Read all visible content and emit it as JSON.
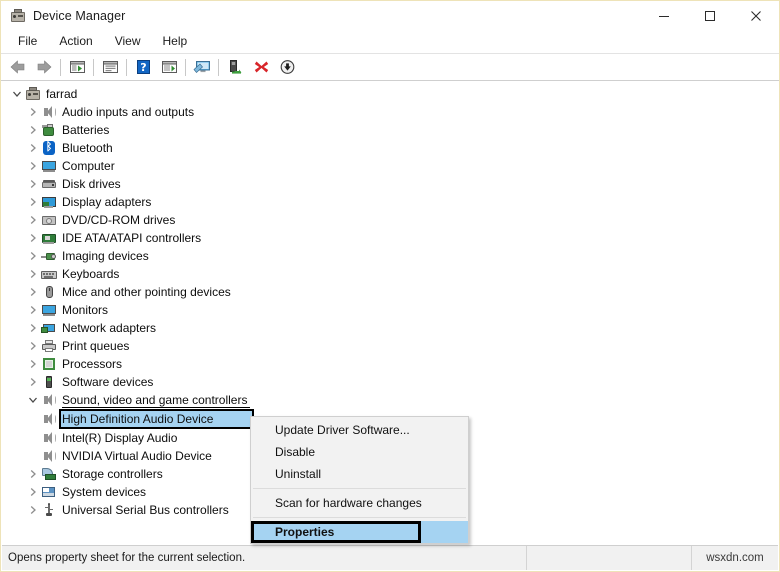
{
  "window": {
    "title": "Device Manager",
    "icon": "device-manager-icon",
    "border_color": "#eee3b8",
    "controls": [
      {
        "name": "minimize-button",
        "glyph": "minimize"
      },
      {
        "name": "maximize-button",
        "glyph": "maximize"
      },
      {
        "name": "close-button",
        "glyph": "close"
      }
    ]
  },
  "menubar": {
    "items": [
      {
        "label": "File"
      },
      {
        "label": "Action"
      },
      {
        "label": "View"
      },
      {
        "label": "Help"
      }
    ]
  },
  "toolbar": {
    "buttons": [
      {
        "name": "back-button",
        "icon": "back-arrow-icon"
      },
      {
        "name": "forward-button",
        "icon": "forward-arrow-icon"
      },
      {
        "name": "show-hide-console-tree-button",
        "icon": "console-tree-icon"
      },
      {
        "name": "properties-button",
        "icon": "properties-window-icon"
      },
      {
        "name": "help-button",
        "icon": "help-question-icon"
      },
      {
        "name": "update-driver-button",
        "icon": "update-driver-icon"
      },
      {
        "name": "scan-hardware-changes-button",
        "icon": "scan-hardware-icon"
      },
      {
        "name": "enable-device-button",
        "icon": "enable-device-icon"
      },
      {
        "name": "uninstall-device-button",
        "icon": "uninstall-red-x-icon"
      },
      {
        "name": "disable-device-button",
        "icon": "disable-down-arrow-icon"
      }
    ]
  },
  "tree": {
    "root": {
      "label": "farrad",
      "icon": "computer-device-icon",
      "expanded": true
    },
    "nodes": [
      {
        "label": "Audio inputs and outputs",
        "icon": "speaker-icon",
        "expanded": false,
        "indent": 1
      },
      {
        "label": "Batteries",
        "icon": "battery-icon",
        "expanded": false,
        "indent": 1
      },
      {
        "label": "Bluetooth",
        "icon": "bluetooth-icon",
        "expanded": false,
        "indent": 1
      },
      {
        "label": "Computer",
        "icon": "monitor-icon",
        "expanded": false,
        "indent": 1
      },
      {
        "label": "Disk drives",
        "icon": "disk-drive-icon",
        "expanded": false,
        "indent": 1
      },
      {
        "label": "Display adapters",
        "icon": "display-adapter-icon",
        "expanded": false,
        "indent": 1
      },
      {
        "label": "DVD/CD-ROM drives",
        "icon": "dvd-drive-icon",
        "expanded": false,
        "indent": 1
      },
      {
        "label": "IDE ATA/ATAPI controllers",
        "icon": "ide-controller-icon",
        "expanded": false,
        "indent": 1
      },
      {
        "label": "Imaging devices",
        "icon": "camera-icon",
        "expanded": false,
        "indent": 1
      },
      {
        "label": "Keyboards",
        "icon": "keyboard-icon",
        "expanded": false,
        "indent": 1
      },
      {
        "label": "Mice and other pointing devices",
        "icon": "mouse-icon",
        "expanded": false,
        "indent": 1
      },
      {
        "label": "Monitors",
        "icon": "monitor-icon",
        "expanded": false,
        "indent": 1
      },
      {
        "label": "Network adapters",
        "icon": "network-adapter-icon",
        "expanded": false,
        "indent": 1
      },
      {
        "label": "Print queues",
        "icon": "printer-icon",
        "expanded": false,
        "indent": 1
      },
      {
        "label": "Processors",
        "icon": "processor-icon",
        "expanded": false,
        "indent": 1
      },
      {
        "label": "Software devices",
        "icon": "software-device-icon",
        "expanded": false,
        "indent": 1
      },
      {
        "label": "Sound, video and game controllers",
        "icon": "speaker-icon",
        "expanded": true,
        "indent": 1,
        "underlined": true
      },
      {
        "label": "High Definition Audio Device",
        "icon": "speaker-icon",
        "expanded": null,
        "indent": 2,
        "selected": true
      },
      {
        "label": "Intel(R) Display Audio",
        "icon": "speaker-icon",
        "expanded": null,
        "indent": 2
      },
      {
        "label": "NVIDIA Virtual Audio Device",
        "icon": "speaker-icon",
        "expanded": null,
        "indent": 2
      },
      {
        "label": "Storage controllers",
        "icon": "storage-controller-icon",
        "expanded": false,
        "indent": 1
      },
      {
        "label": "System devices",
        "icon": "system-device-icon",
        "expanded": false,
        "indent": 1
      },
      {
        "label": "Universal Serial Bus controllers",
        "icon": "usb-controller-icon",
        "expanded": false,
        "indent": 1
      }
    ],
    "selection_color": "#a5d3f2",
    "selection_outline_color": "#000000"
  },
  "context_menu": {
    "items": [
      {
        "label": "Update Driver Software...",
        "type": "item"
      },
      {
        "label": "Disable",
        "type": "item"
      },
      {
        "label": "Uninstall",
        "type": "item"
      },
      {
        "type": "separator"
      },
      {
        "label": "Scan for hardware changes",
        "type": "item"
      },
      {
        "type": "separator"
      }
    ],
    "highlighted": {
      "label": "Properties",
      "highlight_color": "#a5d3f2",
      "outline_color": "#000000"
    }
  },
  "statusbar": {
    "text": "Opens property sheet for the current selection.",
    "watermark": "wsxdn.com"
  }
}
